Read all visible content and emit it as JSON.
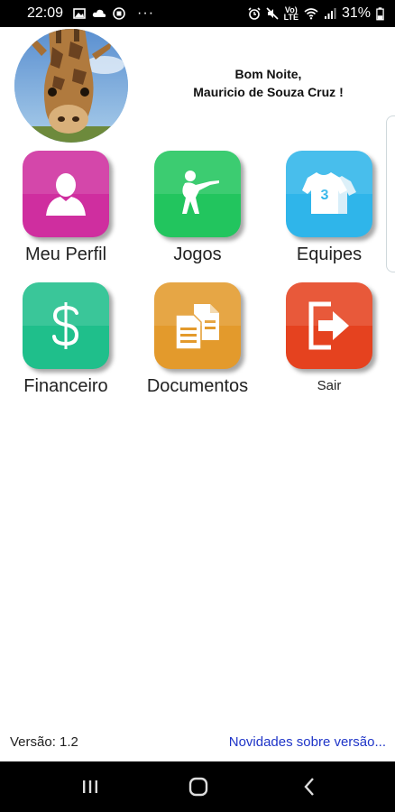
{
  "status_bar": {
    "time": "22:09",
    "battery": "31%",
    "more": "···",
    "network_top": "Vo)",
    "network_bottom": "LTE",
    "icons": [
      "image-icon",
      "cloud-icon",
      "media-icon",
      "alarm-icon",
      "mute-icon",
      "wifi-icon",
      "signal-icon",
      "battery-icon"
    ]
  },
  "header": {
    "greeting_line1": "Bom Noite,",
    "greeting_line2": "Mauricio de Souza Cruz !"
  },
  "menu": [
    {
      "label": "Meu Perfil",
      "color": "#cf2e9f",
      "icon": "user-icon"
    },
    {
      "label": "Jogos",
      "color": "#22c55e",
      "icon": "shooter-icon"
    },
    {
      "label": "Equipes",
      "color": "#2fb5ea",
      "icon": "jersey-icon"
    },
    {
      "label": "Financeiro",
      "color": "#1fbf8b",
      "icon": "dollar-icon"
    },
    {
      "label": "Documentos",
      "color": "#e39a2c",
      "icon": "documents-icon"
    },
    {
      "label": "Sair",
      "color": "#e5421f",
      "icon": "exit-icon"
    }
  ],
  "jersey_number": "3",
  "footer": {
    "version": "Versão: 1.2",
    "news_link": "Novidades sobre versão..."
  }
}
